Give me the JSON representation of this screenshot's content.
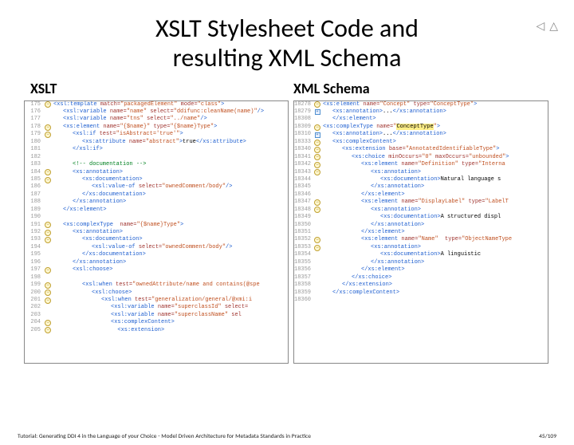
{
  "nav": {
    "back": "◁",
    "up": "△",
    "blank": " "
  },
  "title_line1": "XSLT Stylesheet Code and",
  "title_line2": "resulting XML Schema",
  "subtitle_left": "XSLT",
  "subtitle_right": "XML Schema",
  "footer_text": "Tutorial: Generating DDI 4 in the Language of your Choice - Model Driven Architecture for Metadata Standards in Practice",
  "footer_page": "45/109",
  "xslt": [
    {
      "n": "175",
      "g": "y",
      "i": 0,
      "seg": [
        {
          "c": "tag",
          "t": "<xsl:template "
        },
        {
          "c": "attr",
          "t": "match="
        },
        {
          "c": "val",
          "t": "\"packagedElement\" "
        },
        {
          "c": "attr",
          "t": "mode="
        },
        {
          "c": "val",
          "t": "\"class\""
        },
        {
          "c": "tag",
          "t": ">"
        }
      ]
    },
    {
      "n": "176",
      "g": "",
      "i": 1,
      "seg": [
        {
          "c": "tag",
          "t": "<xsl:variable "
        },
        {
          "c": "attr",
          "t": "name="
        },
        {
          "c": "val",
          "t": "\"name\" "
        },
        {
          "c": "attr",
          "t": "select="
        },
        {
          "c": "val",
          "t": "\"ddifunc:cleanName(name)\""
        },
        {
          "c": "tag",
          "t": "/>"
        }
      ]
    },
    {
      "n": "177",
      "g": "",
      "i": 1,
      "seg": [
        {
          "c": "tag",
          "t": "<xsl:variable "
        },
        {
          "c": "attr",
          "t": "name="
        },
        {
          "c": "val",
          "t": "\"tns\" "
        },
        {
          "c": "attr",
          "t": "select="
        },
        {
          "c": "val",
          "t": "\"../name\""
        },
        {
          "c": "tag",
          "t": "/>"
        }
      ]
    },
    {
      "n": "178",
      "g": "y",
      "i": 1,
      "seg": [
        {
          "c": "tag",
          "t": "<xs:element "
        },
        {
          "c": "attr",
          "t": "name="
        },
        {
          "c": "val",
          "t": "\"{$name}\" "
        },
        {
          "c": "attr",
          "t": "type="
        },
        {
          "c": "val",
          "t": "\"{$name}Type\""
        },
        {
          "c": "tag",
          "t": ">"
        }
      ]
    },
    {
      "n": "179",
      "g": "y",
      "i": 2,
      "seg": [
        {
          "c": "tag",
          "t": "<xsl:if "
        },
        {
          "c": "attr",
          "t": "test="
        },
        {
          "c": "val",
          "t": "\"isAbstract='true'\""
        },
        {
          "c": "tag",
          "t": ">"
        }
      ]
    },
    {
      "n": "180",
      "g": "",
      "i": 3,
      "seg": [
        {
          "c": "tag",
          "t": "<xs:attribute "
        },
        {
          "c": "attr",
          "t": "name="
        },
        {
          "c": "val",
          "t": "\"abstract\""
        },
        {
          "c": "tag",
          "t": ">"
        },
        {
          "c": "txt",
          "t": "true"
        },
        {
          "c": "tag",
          "t": "</xs:attribute>"
        }
      ]
    },
    {
      "n": "181",
      "g": "",
      "i": 2,
      "seg": [
        {
          "c": "tag",
          "t": "</xsl:if>"
        }
      ]
    },
    {
      "n": "182",
      "g": "",
      "i": 0,
      "seg": [
        {
          "c": "txt",
          "t": ""
        }
      ]
    },
    {
      "n": "183",
      "g": "",
      "i": 2,
      "seg": [
        {
          "c": "cm",
          "t": "<!-- documentation -->"
        }
      ]
    },
    {
      "n": "184",
      "g": "y",
      "i": 2,
      "seg": [
        {
          "c": "tag",
          "t": "<xs:annotation>"
        }
      ]
    },
    {
      "n": "185",
      "g": "y",
      "i": 3,
      "seg": [
        {
          "c": "tag",
          "t": "<xs:documentation>"
        }
      ]
    },
    {
      "n": "186",
      "g": "",
      "i": 4,
      "seg": [
        {
          "c": "tag",
          "t": "<xsl:value-of "
        },
        {
          "c": "attr",
          "t": "select="
        },
        {
          "c": "val",
          "t": "\"ownedComment/body\""
        },
        {
          "c": "tag",
          "t": "/>"
        }
      ]
    },
    {
      "n": "187",
      "g": "",
      "i": 3,
      "seg": [
        {
          "c": "tag",
          "t": "</xs:documentation>"
        }
      ]
    },
    {
      "n": "188",
      "g": "",
      "i": 2,
      "seg": [
        {
          "c": "tag",
          "t": "</xs:annotation>"
        }
      ]
    },
    {
      "n": "189",
      "g": "",
      "i": 1,
      "seg": [
        {
          "c": "tag",
          "t": "</xs:element>"
        }
      ]
    },
    {
      "n": "190",
      "g": "",
      "i": 0,
      "seg": [
        {
          "c": "txt",
          "t": ""
        }
      ]
    },
    {
      "n": "191",
      "g": "y",
      "i": 1,
      "seg": [
        {
          "c": "tag",
          "t": "<xs:complexType  "
        },
        {
          "c": "attr",
          "t": "name="
        },
        {
          "c": "val",
          "t": "\"{$name}Type\""
        },
        {
          "c": "tag",
          "t": ">"
        }
      ]
    },
    {
      "n": "192",
      "g": "y",
      "i": 2,
      "seg": [
        {
          "c": "tag",
          "t": "<xs:annotation>"
        }
      ]
    },
    {
      "n": "193",
      "g": "y",
      "i": 3,
      "seg": [
        {
          "c": "tag",
          "t": "<xs:documentation>"
        }
      ]
    },
    {
      "n": "194",
      "g": "",
      "i": 4,
      "seg": [
        {
          "c": "tag",
          "t": "<xsl:value-of "
        },
        {
          "c": "attr",
          "t": "select="
        },
        {
          "c": "val",
          "t": "\"ownedComment/body\""
        },
        {
          "c": "tag",
          "t": "/>"
        }
      ]
    },
    {
      "n": "195",
      "g": "",
      "i": 3,
      "seg": [
        {
          "c": "tag",
          "t": "</xs:documentation>"
        }
      ]
    },
    {
      "n": "196",
      "g": "",
      "i": 2,
      "seg": [
        {
          "c": "tag",
          "t": "</xs:annotation>"
        }
      ]
    },
    {
      "n": "197",
      "g": "y",
      "i": 2,
      "seg": [
        {
          "c": "tag",
          "t": "<xsl:choose>"
        }
      ]
    },
    {
      "n": "198",
      "g": "",
      "i": 0,
      "seg": [
        {
          "c": "txt",
          "t": ""
        }
      ]
    },
    {
      "n": "199",
      "g": "y",
      "i": 3,
      "seg": [
        {
          "c": "tag",
          "t": "<xsl:when "
        },
        {
          "c": "attr",
          "t": "test="
        },
        {
          "c": "val",
          "t": "\"ownedAttribute/name and contains(@spe"
        }
      ]
    },
    {
      "n": "200",
      "g": "y",
      "i": 4,
      "seg": [
        {
          "c": "tag",
          "t": "<xsl:choose>"
        }
      ]
    },
    {
      "n": "201",
      "g": "y",
      "i": 5,
      "seg": [
        {
          "c": "tag",
          "t": "<xsl:when "
        },
        {
          "c": "attr",
          "t": "test="
        },
        {
          "c": "val",
          "t": "\"generalization/general/@xmi:i"
        }
      ]
    },
    {
      "n": "202",
      "g": "",
      "i": 6,
      "seg": [
        {
          "c": "tag",
          "t": "<xsl:variable "
        },
        {
          "c": "attr",
          "t": "name="
        },
        {
          "c": "val",
          "t": "\"superclassId\" "
        },
        {
          "c": "attr",
          "t": "select="
        }
      ]
    },
    {
      "n": "203",
      "g": "",
      "i": 6,
      "seg": [
        {
          "c": "tag",
          "t": "<xsl:variable "
        },
        {
          "c": "attr",
          "t": "name="
        },
        {
          "c": "val",
          "t": "\"superclassName\" "
        },
        {
          "c": "attr",
          "t": "sel"
        }
      ]
    },
    {
      "n": "204",
      "g": "y",
      "i": 6,
      "seg": [
        {
          "c": "tag",
          "t": "<xs:complexContent>"
        }
      ]
    },
    {
      "n": "205",
      "g": "y",
      "i": 6,
      "seg": [
        {
          "c": "tag",
          "t": "  <xs:extension>"
        }
      ]
    }
  ],
  "xml": [
    {
      "n": "18278",
      "g": "y",
      "i": 0,
      "seg": [
        {
          "c": "tag",
          "t": "<xs:element "
        },
        {
          "c": "attr",
          "t": "name="
        },
        {
          "c": "val",
          "t": "\"Concept\" "
        },
        {
          "c": "attr",
          "t": "type="
        },
        {
          "c": "val",
          "t": "\"ConceptType\""
        },
        {
          "c": "tag",
          "t": ">"
        }
      ]
    },
    {
      "n": "18279",
      "g": "b",
      "i": 1,
      "seg": [
        {
          "c": "tag",
          "t": "<xs:annotation>"
        },
        {
          "c": "txt",
          "t": "..."
        },
        {
          "c": "tag",
          "t": "</xs:annotation>"
        }
      ]
    },
    {
      "n": "18308",
      "g": "",
      "i": 1,
      "seg": [
        {
          "c": "tag",
          "t": "</xs:element>"
        }
      ]
    },
    {
      "n": "18309",
      "g": "y",
      "i": 0,
      "seg": [
        {
          "c": "tag",
          "t": "<xs:complexType "
        },
        {
          "c": "attr",
          "t": "name="
        },
        {
          "c": "val",
          "t": "\""
        },
        {
          "c": "hl",
          "t": "ConceptType"
        },
        {
          "c": "val",
          "t": "\""
        },
        {
          "c": "tag",
          "t": ">"
        }
      ]
    },
    {
      "n": "18310",
      "g": "b",
      "i": 1,
      "seg": [
        {
          "c": "tag",
          "t": "<xs:annotation>"
        },
        {
          "c": "txt",
          "t": "..."
        },
        {
          "c": "tag",
          "t": "</xs:annotation>"
        }
      ]
    },
    {
      "n": "18333",
      "g": "y",
      "i": 1,
      "seg": [
        {
          "c": "tag",
          "t": "<xs:complexContent>"
        }
      ]
    },
    {
      "n": "18340",
      "g": "y",
      "i": 2,
      "seg": [
        {
          "c": "tag",
          "t": "<xs:extension "
        },
        {
          "c": "attr",
          "t": "base="
        },
        {
          "c": "val",
          "t": "\"AnnotatedIdentifiableType\""
        },
        {
          "c": "tag",
          "t": ">"
        }
      ]
    },
    {
      "n": "18341",
      "g": "y",
      "i": 3,
      "seg": [
        {
          "c": "tag",
          "t": "<xs:choice "
        },
        {
          "c": "attr",
          "t": "minOccurs="
        },
        {
          "c": "val",
          "t": "\"0\" "
        },
        {
          "c": "attr",
          "t": "maxOccurs="
        },
        {
          "c": "val",
          "t": "\"unbounded\""
        },
        {
          "c": "tag",
          "t": ">"
        }
      ]
    },
    {
      "n": "18342",
      "g": "y",
      "i": 4,
      "seg": [
        {
          "c": "tag",
          "t": "<xs:element "
        },
        {
          "c": "attr",
          "t": "name="
        },
        {
          "c": "val",
          "t": "\"Definition\" "
        },
        {
          "c": "attr",
          "t": "type="
        },
        {
          "c": "val",
          "t": "\"Interna"
        }
      ]
    },
    {
      "n": "18343",
      "g": "y",
      "i": 5,
      "seg": [
        {
          "c": "tag",
          "t": "<xs:annotation>"
        }
      ]
    },
    {
      "n": "18344",
      "g": "",
      "i": 6,
      "seg": [
        {
          "c": "tag",
          "t": "<xs:documentation>"
        },
        {
          "c": "txt",
          "t": "Natural language s"
        }
      ]
    },
    {
      "n": "18345",
      "g": "",
      "i": 5,
      "seg": [
        {
          "c": "tag",
          "t": "</xs:annotation>"
        }
      ]
    },
    {
      "n": "18346",
      "g": "",
      "i": 4,
      "seg": [
        {
          "c": "tag",
          "t": "</xs:element>"
        }
      ]
    },
    {
      "n": "18347",
      "g": "y",
      "i": 4,
      "seg": [
        {
          "c": "tag",
          "t": "<xs:element "
        },
        {
          "c": "attr",
          "t": "name="
        },
        {
          "c": "val",
          "t": "\"DisplayLabel\" "
        },
        {
          "c": "attr",
          "t": "type="
        },
        {
          "c": "val",
          "t": "\"LabelT"
        }
      ]
    },
    {
      "n": "18348",
      "g": "y",
      "i": 5,
      "seg": [
        {
          "c": "tag",
          "t": "<xs:annotation>"
        }
      ]
    },
    {
      "n": "18349",
      "g": "",
      "i": 6,
      "seg": [
        {
          "c": "tag",
          "t": "<xs:documentation>"
        },
        {
          "c": "txt",
          "t": "A structured displ"
        }
      ]
    },
    {
      "n": "18350",
      "g": "",
      "i": 5,
      "seg": [
        {
          "c": "tag",
          "t": "</xs:annotation>"
        }
      ]
    },
    {
      "n": "18351",
      "g": "",
      "i": 4,
      "seg": [
        {
          "c": "tag",
          "t": "</xs:element>"
        }
      ]
    },
    {
      "n": "18352",
      "g": "y",
      "i": 4,
      "seg": [
        {
          "c": "tag",
          "t": "<xs:element "
        },
        {
          "c": "attr",
          "t": "name="
        },
        {
          "c": "val",
          "t": "\"Name\"  "
        },
        {
          "c": "attr",
          "t": "type="
        },
        {
          "c": "val",
          "t": "\"ObjectNameType"
        }
      ]
    },
    {
      "n": "18353",
      "g": "y",
      "i": 5,
      "seg": [
        {
          "c": "tag",
          "t": "<xs:annotation>"
        }
      ]
    },
    {
      "n": "18354",
      "g": "",
      "i": 6,
      "seg": [
        {
          "c": "tag",
          "t": "<xs:documentation>"
        },
        {
          "c": "txt",
          "t": "A linguistic"
        }
      ]
    },
    {
      "n": "18355",
      "g": "",
      "i": 5,
      "seg": [
        {
          "c": "tag",
          "t": "</xs:annotation>"
        }
      ]
    },
    {
      "n": "18356",
      "g": "",
      "i": 4,
      "seg": [
        {
          "c": "tag",
          "t": "</xs:element>"
        }
      ]
    },
    {
      "n": "18357",
      "g": "",
      "i": 3,
      "seg": [
        {
          "c": "tag",
          "t": "</xs:choice>"
        }
      ]
    },
    {
      "n": "18358",
      "g": "",
      "i": 2,
      "seg": [
        {
          "c": "tag",
          "t": "</xs:extension>"
        }
      ]
    },
    {
      "n": "18359",
      "g": "",
      "i": 1,
      "seg": [
        {
          "c": "tag",
          "t": "</xs:complexContent>"
        }
      ]
    },
    {
      "n": "18360",
      "g": "",
      "i": 0,
      "seg": [
        {
          "c": "txt",
          "t": ""
        }
      ]
    }
  ]
}
